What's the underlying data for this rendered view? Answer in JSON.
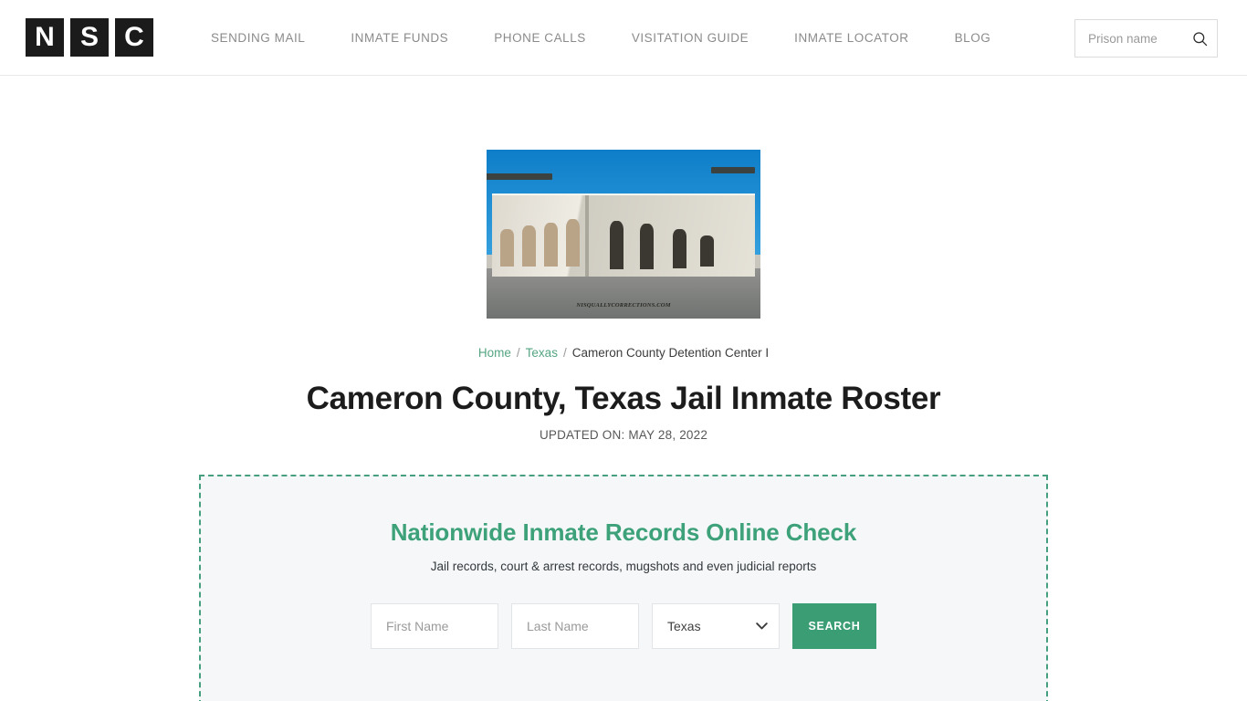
{
  "header": {
    "logo_tiles": [
      "N",
      "S",
      "C"
    ],
    "nav": [
      {
        "label": "SENDING MAIL"
      },
      {
        "label": "INMATE FUNDS"
      },
      {
        "label": "PHONE CALLS"
      },
      {
        "label": "VISITATION GUIDE"
      },
      {
        "label": "INMATE LOCATOR"
      },
      {
        "label": "BLOG"
      }
    ],
    "search": {
      "placeholder": "Prison name",
      "value": "",
      "icon": "search-icon"
    }
  },
  "hero": {
    "image_alt": "Cameron County Detention Center I building exterior",
    "watermark": "NISQUALLYCORRECTIONS.COM"
  },
  "breadcrumb": {
    "home": "Home",
    "state": "Texas",
    "current": "Cameron County Detention Center I",
    "separator": "/"
  },
  "page": {
    "title": "Cameron County, Texas Jail Inmate Roster",
    "updated": "UPDATED ON: MAY 28, 2022"
  },
  "widget": {
    "title": "Nationwide Inmate Records Online Check",
    "subtitle": "Jail records, court & arrest records, mugshots and even judicial reports",
    "first_name_placeholder": "First Name",
    "first_name_value": "",
    "last_name_placeholder": "Last Name",
    "last_name_value": "",
    "state_selected": "Texas",
    "state_options": [
      "Texas"
    ],
    "search_label": "SEARCH",
    "border_color": "#46a07f",
    "accent_color": "#3a9d74",
    "background_color": "#f5f7f8"
  }
}
